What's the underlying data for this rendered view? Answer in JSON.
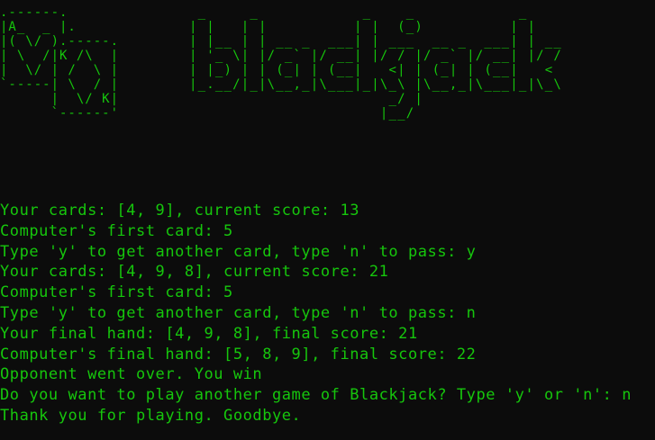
{
  "banner": {
    "card_art": ".------.\n|A_  _ |.\n|( \\/ ).-----.\n| \\  /|K /\\  |\n|  \\/ | /  \\ |\n`-----| \\  / |\n      |  \\/ K|\n      `------'",
    "logo_art": " _     _            _    _            _\n| |   | |          | |  (_)          | |\n| |__ | | __ _  ___| | ___  __ _  ___| | __\n| '_ \\| |/ _` |/ __| |/ / |/ _` |/ __| |/ /\n| |_) | | (_| | (__|   <| | (_| | (__|   <\n|_.__/|_|\\__,_|\\___|_|\\_\\ |\\__,_|\\___|_|\\_\\\n                       _/ |\n                      |__/"
  },
  "output": {
    "lines": [
      "Your cards: [4, 9], current score: 13",
      "Computer's first card: 5",
      "Type 'y' to get another card, type 'n' to pass: y",
      "Your cards: [4, 9, 8], current score: 21",
      "Computer's first card: 5",
      "Type 'y' to get another card, type 'n' to pass: n",
      "Your final hand: [4, 9, 8], final score: 21",
      "Computer's final hand: [5, 8, 9], final score: 22",
      "Opponent went over. You win",
      "Do you want to play another game of Blackjack? Type 'y' or 'n': n",
      "Thank you for playing. Goodbye."
    ]
  },
  "colors": {
    "background": "#0c0c0c",
    "text": "#16c60c"
  }
}
